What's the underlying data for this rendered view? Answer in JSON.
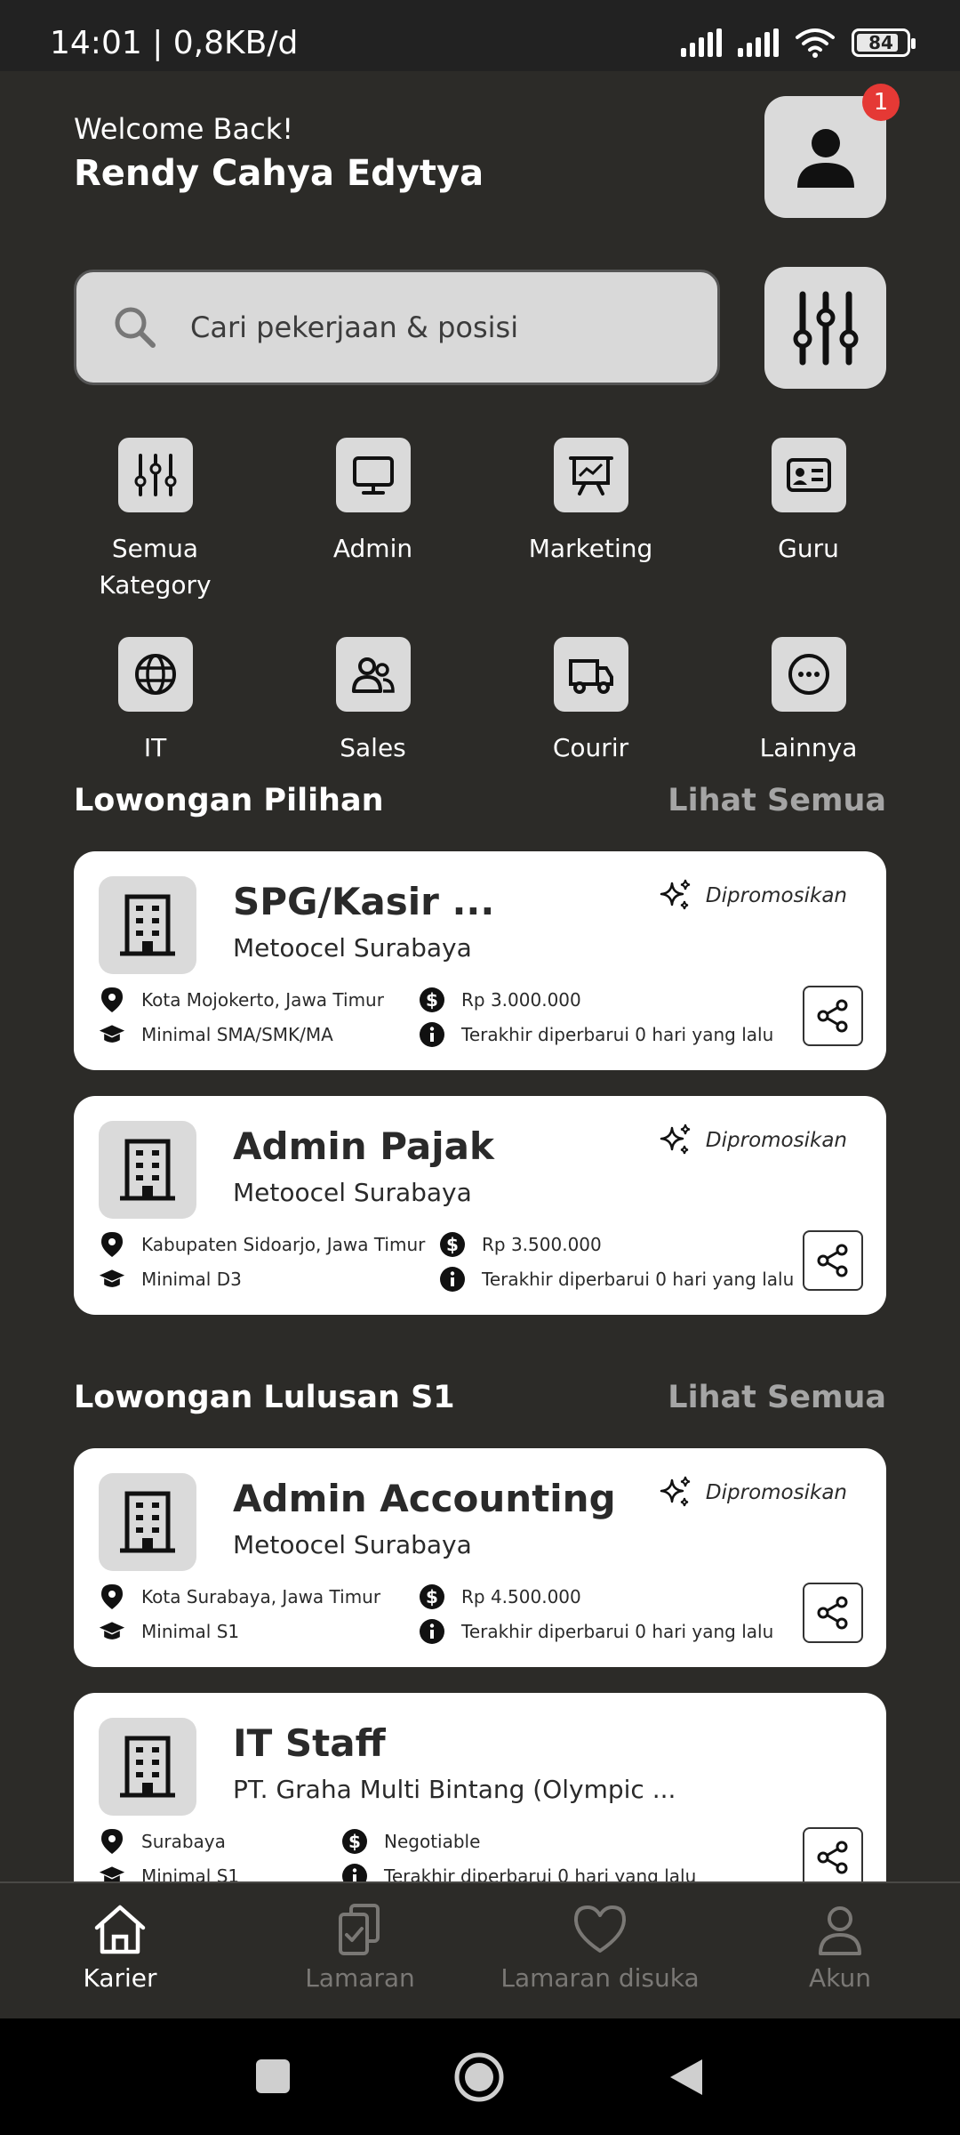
{
  "status_bar": {
    "time": "14:01 | 0,8KB/d",
    "battery": "84"
  },
  "header": {
    "welcome": "Welcome Back!",
    "username": "Rendy Cahya Edytya",
    "notification_count": "1"
  },
  "search": {
    "placeholder": "Cari pekerjaan & posisi"
  },
  "categories": [
    {
      "label": "Semua Kategory",
      "icon": "sliders-icon"
    },
    {
      "label": "Admin",
      "icon": "monitor-icon"
    },
    {
      "label": "Marketing",
      "icon": "presentation-chart-icon"
    },
    {
      "label": "Guru",
      "icon": "id-card-icon"
    },
    {
      "label": "IT",
      "icon": "globe-icon"
    },
    {
      "label": "Sales",
      "icon": "users-icon"
    },
    {
      "label": "Courir",
      "icon": "truck-icon"
    },
    {
      "label": "Lainnya",
      "icon": "more-icon"
    }
  ],
  "section_featured": {
    "title": "Lowongan Pilihan",
    "link": "Lihat Semua"
  },
  "section_s1": {
    "title": "Lowongan Lulusan S1",
    "link": "Lihat Semua"
  },
  "promo_label": "Dipromosikan",
  "jobs": [
    {
      "title": "SPG/Kasir ...",
      "company": "Metoocel Surabaya",
      "location": "Kota Mojokerto, Jawa Timur",
      "education": "Minimal SMA/SMK/MA",
      "salary": "Rp 3.000.000",
      "updated": "Terakhir diperbarui 0 hari yang lalu"
    },
    {
      "title": "Admin Pajak",
      "company": "Metoocel Surabaya",
      "location": "Kabupaten Sidoarjo, Jawa Timur",
      "education": "Minimal D3",
      "salary": "Rp 3.500.000",
      "updated": "Terakhir diperbarui 0 hari yang lalu"
    },
    {
      "title": "Admin Accounting",
      "company": "Metoocel Surabaya",
      "location": "Kota Surabaya, Jawa Timur",
      "education": "Minimal S1",
      "salary": "Rp 4.500.000",
      "updated": "Terakhir diperbarui 0 hari yang lalu"
    },
    {
      "title": "IT Staff",
      "company": "PT. Graha Multi Bintang (Olympic ...",
      "location": "Surabaya",
      "education": "Minimal S1",
      "salary": "Negotiable",
      "updated": "Terakhir diperbarui 0 hari yang lalu"
    }
  ],
  "bottom_nav": [
    {
      "label": "Karier",
      "icon": "home-icon",
      "active": true
    },
    {
      "label": "Lamaran",
      "icon": "clipboard-check-icon",
      "active": false
    },
    {
      "label": "Lamaran disuka",
      "icon": "heart-icon",
      "active": false
    },
    {
      "label": "Akun",
      "icon": "user-icon",
      "active": false
    }
  ],
  "colors": {
    "background": "#2c2b28",
    "card": "#ffffff",
    "tile": "#dadada",
    "badge": "#e53935",
    "muted": "#a5a5a5"
  }
}
